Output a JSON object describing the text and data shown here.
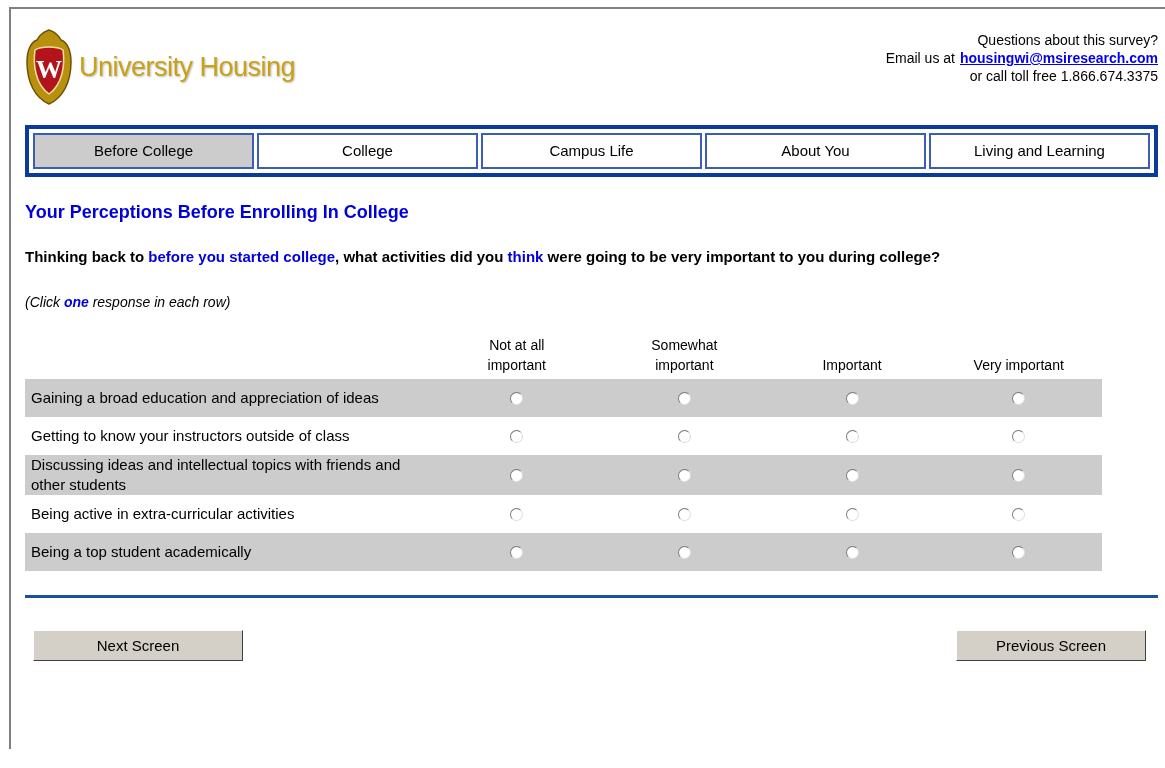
{
  "header": {
    "logo_mark": "W",
    "title": "University Housing",
    "contact": {
      "line_1": "Questions about this survey?",
      "email_prefix": "Email us at",
      "email": "housingwi@msiresearch.com",
      "line_3": "or call toll free 1.866.674.3375"
    }
  },
  "tabs": [
    {
      "label": "Before College",
      "selected": true
    },
    {
      "label": "College",
      "selected": false
    },
    {
      "label": "Campus Life",
      "selected": false
    },
    {
      "label": "About You",
      "selected": false
    },
    {
      "label": "Living and Learning",
      "selected": false
    }
  ],
  "heading": "Your Perceptions Before Enrolling In College",
  "question": "Thinking back to **before you started college**, what activities did you **think** were going to be very important to you during college?",
  "instruction": "(Click **one** response in each row)",
  "table": {
    "columns": [
      "Not at all important",
      "Somewhat important",
      "Important",
      "Very important"
    ],
    "rows": [
      {
        "label": "Gaining a broad education and appreciation of ideas",
        "options": [
          {
            "selected": false
          },
          {
            "selected": false
          },
          {
            "selected": false
          },
          {
            "selected": false
          }
        ]
      },
      {
        "label": "Getting to know your instructors outside of class",
        "options": [
          {
            "selected": false
          },
          {
            "selected": false
          },
          {
            "selected": false
          },
          {
            "selected": false
          }
        ]
      },
      {
        "label": "Discussing ideas and intellectual topics with friends and other students",
        "options": [
          {
            "selected": false
          },
          {
            "selected": false
          },
          {
            "selected": false
          },
          {
            "selected": false
          }
        ]
      },
      {
        "label": "Being active in extra-curricular activities",
        "options": [
          {
            "selected": false
          },
          {
            "selected": false
          },
          {
            "selected": false
          },
          {
            "selected": false
          }
        ]
      },
      {
        "label": "Being a top student academically",
        "options": [
          {
            "selected": false
          },
          {
            "selected": false
          },
          {
            "selected": false
          },
          {
            "selected": false
          }
        ]
      }
    ]
  },
  "buttons": {
    "next": "Next Screen",
    "previous": "Previous Screen"
  }
}
